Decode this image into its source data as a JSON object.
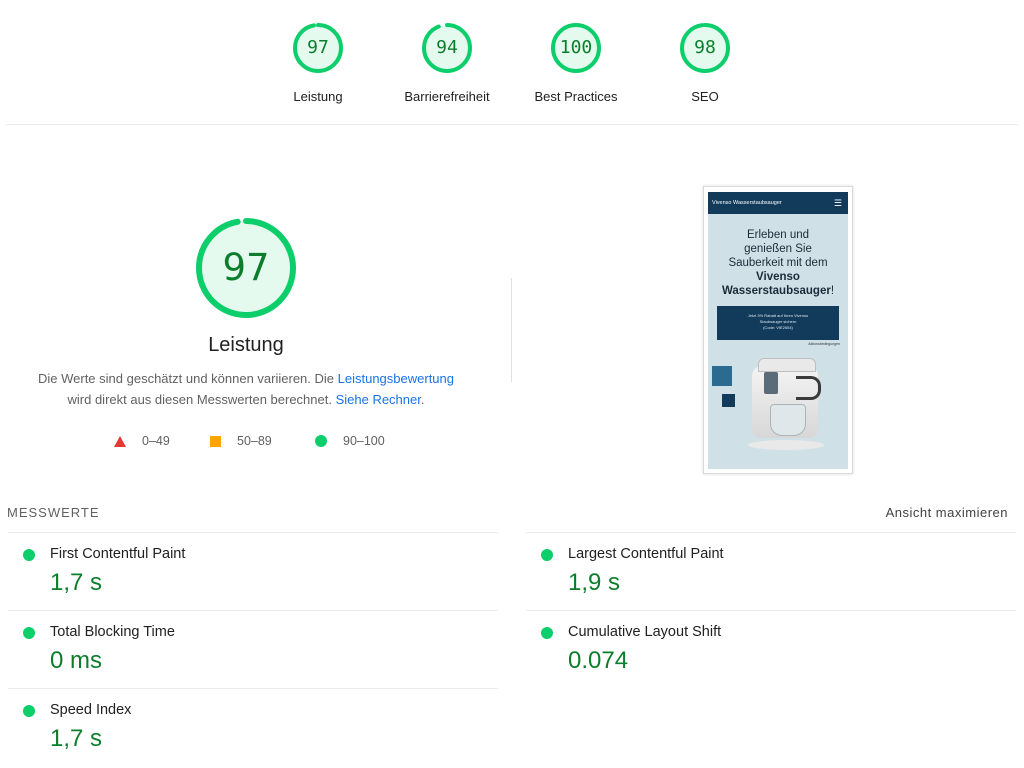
{
  "summary": [
    {
      "score": "97",
      "label": "Leistung",
      "fraction": 0.97
    },
    {
      "score": "94",
      "label": "Barrierefreiheit",
      "fraction": 0.94
    },
    {
      "score": "100",
      "label": "Best Practices",
      "fraction": 1.0
    },
    {
      "score": "98",
      "label": "SEO",
      "fraction": 0.98
    }
  ],
  "performance": {
    "score": "97",
    "fraction": 0.97,
    "title": "Leistung",
    "desc_part1": "Die Werte sind geschätzt und können variieren. Die ",
    "desc_link1": "Leistungsbewertung",
    "desc_part2": "wird direkt aus diesen Messwerten berechnet. ",
    "desc_link2": "Siehe Rechner",
    "desc_end": "."
  },
  "legend": [
    {
      "range": "0–49",
      "icon": "triangle-icon"
    },
    {
      "range": "50–89",
      "icon": "square-icon"
    },
    {
      "range": "90–100",
      "icon": "circle-icon"
    }
  ],
  "thumbnail": {
    "site_title": "Vivenso Wasserstaubsauger",
    "menu_icon": "☰",
    "heading_line1": "Erleben und",
    "heading_line2": "genießen Sie",
    "heading_line3": "Sauberkeit mit dem",
    "heading_bold1": "Vivenso",
    "heading_bold2": "Wasserstaubsauger",
    "heading_end": "!",
    "cta_line1": "Jetzt 3% Rabatt auf Ihren Vivenso",
    "cta_line2": "Staubsauger sichern",
    "cta_line3": "(Code: VIE2654)",
    "small_note": "Aktionsbedingungen"
  },
  "metrics": {
    "title": "MESSWERTE",
    "expand_label": "Ansicht maximieren",
    "items": [
      {
        "label": "First Contentful Paint",
        "value": "1,7 s"
      },
      {
        "label": "Largest Contentful Paint",
        "value": "1,9 s"
      },
      {
        "label": "Total Blocking Time",
        "value": "0 ms"
      },
      {
        "label": "Cumulative Layout Shift",
        "value": "0.074"
      },
      {
        "label": "Speed Index",
        "value": "1,7 s"
      }
    ]
  },
  "colors": {
    "pass": "#0cce6b",
    "pass_text": "#0c7e2b",
    "pass_bg": "#e5faef",
    "average": "#ffa400",
    "fail": "#e53935",
    "link": "#1a73e8"
  }
}
